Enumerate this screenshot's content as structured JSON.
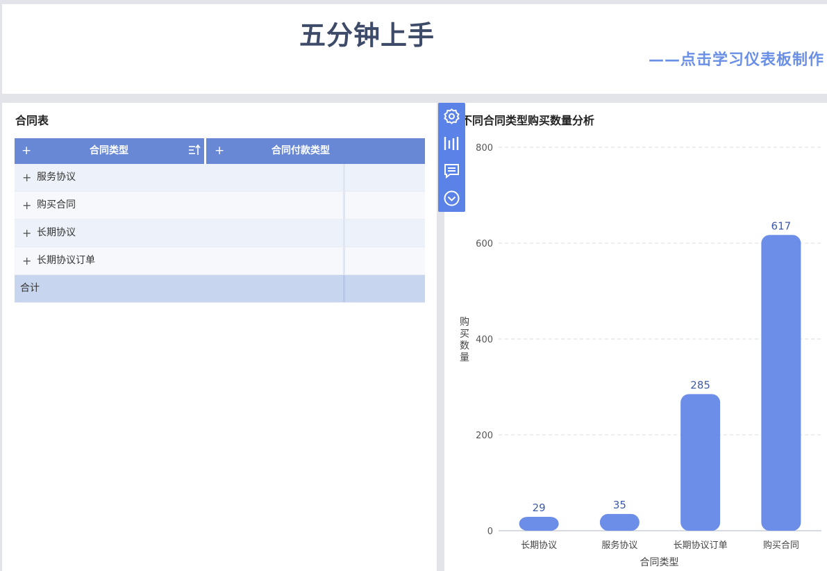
{
  "header": {
    "title": "五分钟上手",
    "subtitle": "——点击学习仪表板制作"
  },
  "left_panel": {
    "title": "合同表",
    "table": {
      "columns": [
        {
          "plus": "+",
          "label": "合同类型",
          "sort_icon": "sort-icon"
        },
        {
          "plus": "+",
          "label": "合同付款类型"
        }
      ],
      "rows": [
        {
          "plus": "+",
          "label": "服务协议"
        },
        {
          "plus": "+",
          "label": "购买合同"
        },
        {
          "plus": "+",
          "label": "长期协议"
        },
        {
          "plus": "+",
          "label": "长期协议订单"
        }
      ],
      "total_label": "合计"
    }
  },
  "toolbar": {
    "icons": [
      "settings-icon",
      "chart-type-icon",
      "comment-icon",
      "collapse-icon"
    ],
    "color": "#5b82e6"
  },
  "right_panel": {
    "title": "不同合同类型购买数量分析"
  },
  "chart_data": {
    "type": "bar",
    "categories": [
      "长期协议",
      "服务协议",
      "长期协议订单",
      "购买合同"
    ],
    "values": [
      29,
      35,
      285,
      617
    ],
    "xlabel": "合同类型",
    "ylabel": "购买数量",
    "ylim": [
      0,
      800
    ],
    "yticks": [
      0,
      200,
      400,
      600,
      800
    ],
    "grid": true,
    "bar_color": "#6d8ee8",
    "label_color": "#3c5aa8"
  }
}
